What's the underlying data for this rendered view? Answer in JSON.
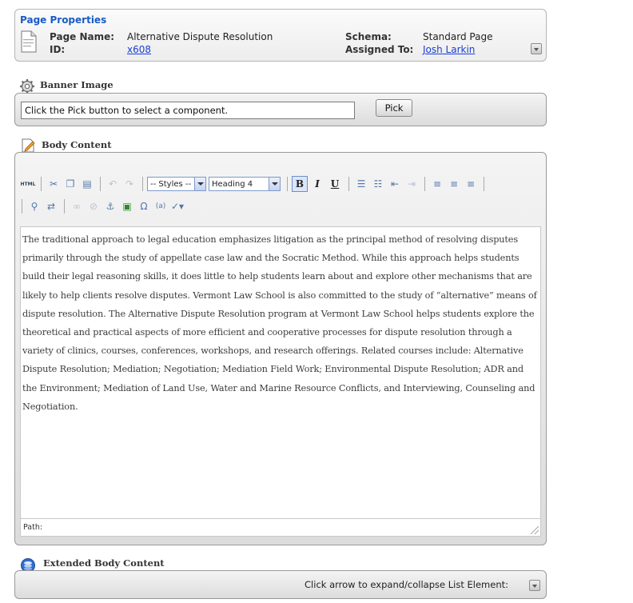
{
  "page_properties": {
    "title": "Page Properties",
    "page_name_label": "Page Name:",
    "page_name_value": "Alternative Dispute Resolution",
    "id_label": "ID:",
    "id_value": "x608",
    "schema_label": "Schema:",
    "schema_value": "Standard Page",
    "assigned_label": "Assigned To:",
    "assigned_value": "Josh Larkin"
  },
  "banner": {
    "title": "Banner Image",
    "input_value": "Click the Pick button to select a component.",
    "pick_label": "Pick"
  },
  "body_content": {
    "title": "Body Content",
    "toolbar": {
      "html_label": "HTML",
      "styles_value": "-- Styles --",
      "format_value": "Heading 4",
      "bold_label": "B",
      "italic_label": "I",
      "underline_label": "U"
    },
    "editor_text": "The traditional approach to legal education emphasizes litigation as the principal method of resolving disputes primarily through the study of appellate case law and the Socratic Method. While this approach helps students build their legal reasoning skills, it does little to help students learn about and explore other mechanisms that are likely to help clients resolve disputes. Vermont Law School is also committed to the study of “alternative” means of dispute resolution. The Alternative Dispute Resolution program at Vermont Law School helps students explore the theoretical and practical aspects of more efficient and cooperative processes for dispute resolution through a variety of clinics, courses, conferences, workshops, and research offerings. Related courses include: Alternative Dispute Resolution; Mediation; Negotiation; Mediation Field Work; Environmental Dispute Resolution; ADR and the Environment; Mediation of Land Use, Water and Marine Resource Conflicts, and Interviewing, Counseling and Negotiation.",
    "path_label": "Path:"
  },
  "extended": {
    "title": "Extended Body Content",
    "hint": "Click arrow to expand/collapse List Element:"
  },
  "colors": {
    "link": "#1a3fd6",
    "title_blue": "#1a5bc4"
  }
}
